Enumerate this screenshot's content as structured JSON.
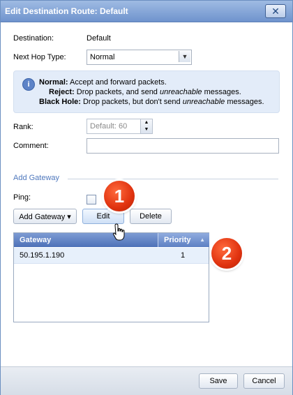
{
  "dialog": {
    "title": "Edit Destination Route: Default",
    "close_symbol": "✕"
  },
  "form": {
    "destination_label": "Destination:",
    "destination_value": "Default",
    "next_hop_label": "Next Hop Type:",
    "next_hop_value": "Normal",
    "rank_label": "Rank:",
    "rank_placeholder": "Default: 60",
    "comment_label": "Comment:",
    "comment_value": ""
  },
  "info": {
    "normal_term": "Normal:",
    "normal_desc": " Accept and forward packets.",
    "reject_term": "Reject:",
    "reject_desc_1": " Drop packets, and send ",
    "reject_desc_em": "unreachable",
    "reject_desc_2": " messages.",
    "blackhole_term": "Black Hole:",
    "blackhole_desc_1": " Drop packets, but don't send ",
    "blackhole_desc_em": "unreachable",
    "blackhole_desc_2": " messages."
  },
  "gateway_section": {
    "title": "Add Gateway",
    "ping_label": "Ping:",
    "add_button": "Add Gateway ▾",
    "edit_button": "Edit",
    "delete_button": "Delete"
  },
  "grid": {
    "col_gateway": "Gateway",
    "col_priority": "Priority",
    "sort_symbol": "▲",
    "rows": [
      {
        "gateway": "50.195.1.190",
        "priority": "1"
      }
    ]
  },
  "callouts": {
    "one": "1",
    "two": "2"
  },
  "footer": {
    "save_label": "Save",
    "cancel_label": "Cancel"
  },
  "colors": {
    "titlebar": "#7b9bd3",
    "accent": "#4f78bd",
    "callout": "#e0320f"
  }
}
